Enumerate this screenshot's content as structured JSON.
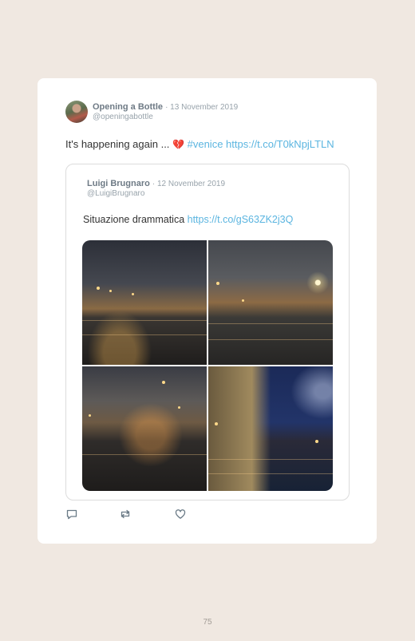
{
  "tweet": {
    "author_name": "Opening a Bottle",
    "date": "· 13 November 2019",
    "handle": "@openingabottle",
    "text_prefix": "It's happening again ... ",
    "emoji": "💔",
    "hashtag": "#venice",
    "link": "https://t.co/T0kNpjLTLN"
  },
  "quoted_tweet": {
    "author_name": "Luigi Brugnaro",
    "date": "· 12 November 2019",
    "handle": "@LuigiBrugnaro",
    "text_prefix": "Situazione drammatica ",
    "link": "https://t.co/gS63ZK2j3Q"
  },
  "actions": {
    "icons": [
      "reply-icon",
      "retweet-icon",
      "like-icon"
    ]
  },
  "page": {
    "number": "75"
  },
  "colors": {
    "background": "#f0e8e1",
    "link": "#5bb5e0",
    "heart": "#d0455a"
  }
}
